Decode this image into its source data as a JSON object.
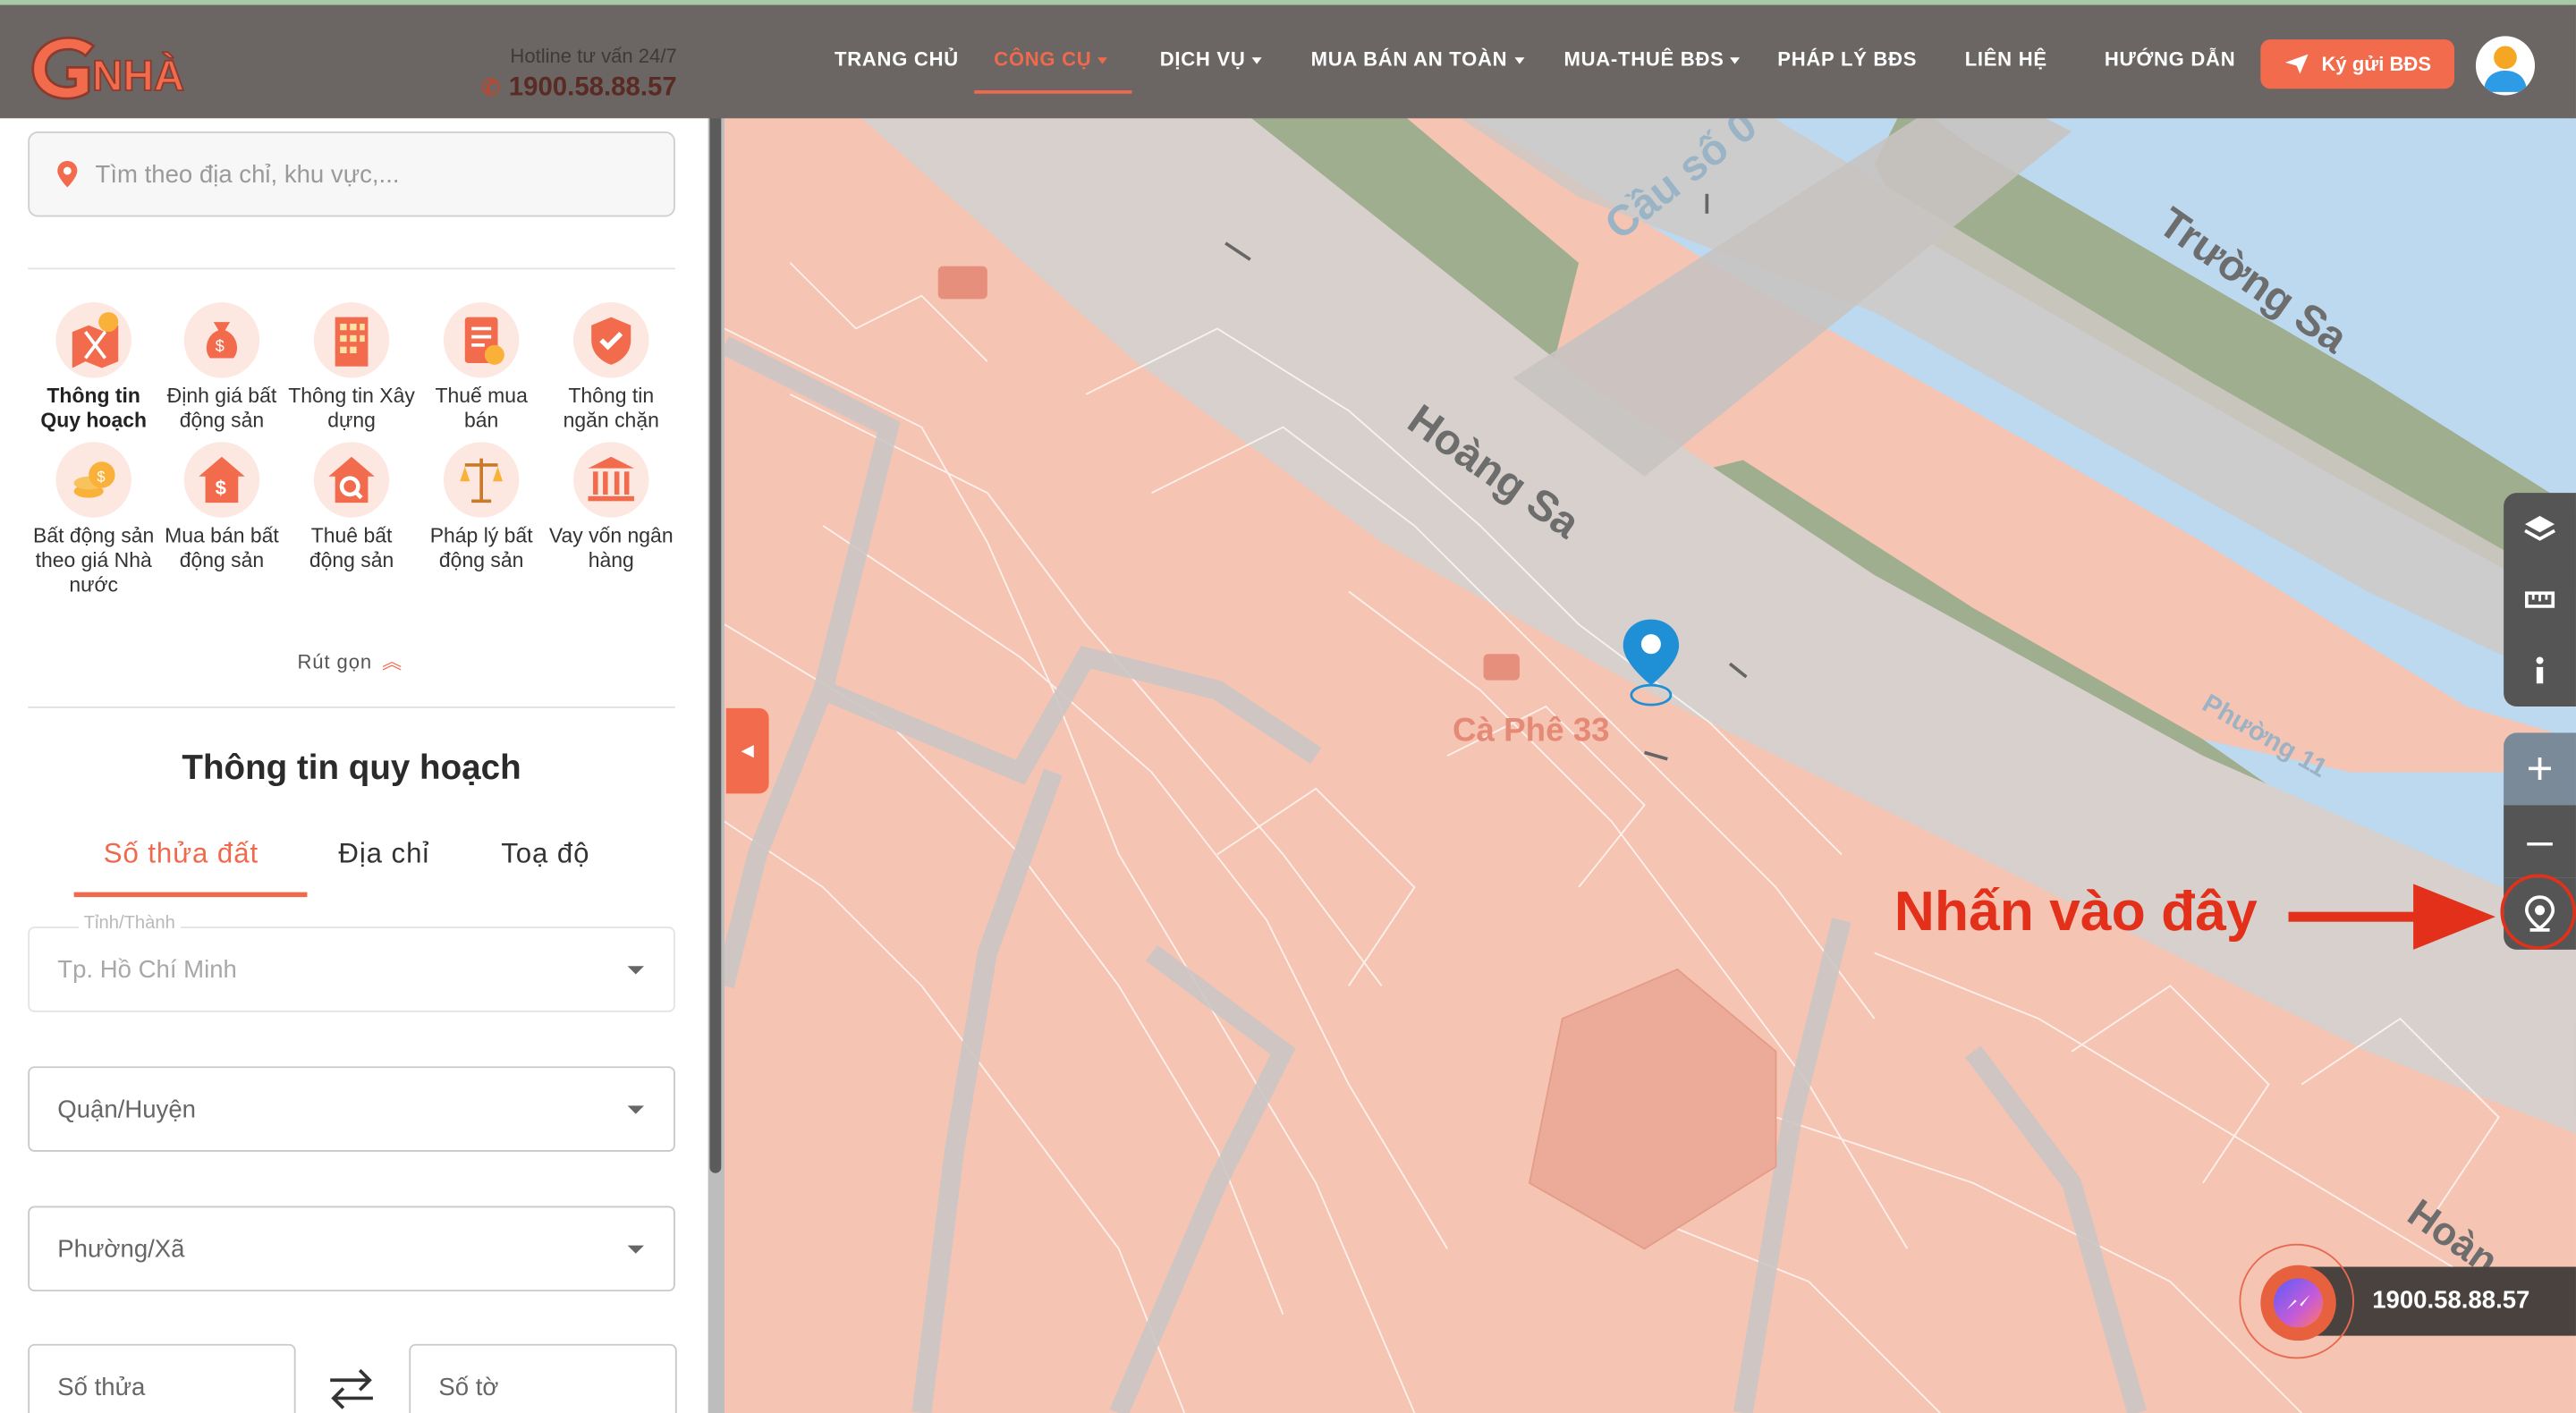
{
  "header": {
    "logo_text": "GNHÀ",
    "hotline_label": "Hotline tư vấn 24/7",
    "hotline_number": "1900.58.88.57",
    "nav": [
      {
        "label": "TRANG CHỦ",
        "has_dropdown": false,
        "active": false
      },
      {
        "label": "CÔNG CỤ",
        "has_dropdown": true,
        "active": true
      },
      {
        "label": "DỊCH VỤ",
        "has_dropdown": true,
        "active": false
      },
      {
        "label": "MUA BÁN AN TOÀN",
        "has_dropdown": true,
        "active": false
      },
      {
        "label": "MUA-THUÊ BĐS",
        "has_dropdown": true,
        "active": false
      },
      {
        "label": "PHÁP LÝ BĐS",
        "has_dropdown": false,
        "active": false
      },
      {
        "label": "LIÊN HỆ",
        "has_dropdown": false,
        "active": false
      },
      {
        "label": "HƯỚNG DẪN",
        "has_dropdown": false,
        "active": false
      }
    ],
    "deposit_label": "Ký gửi BĐS"
  },
  "sidebar": {
    "search_placeholder": "Tìm theo địa chỉ, khu vực,...",
    "tools": [
      {
        "label": "Thông tin Quy hoạch",
        "icon": "planning-map-icon"
      },
      {
        "label": "Định giá bất động sản",
        "icon": "money-bag-icon"
      },
      {
        "label": "Thông tin Xây dựng",
        "icon": "building-icon"
      },
      {
        "label": "Thuế mua bán",
        "icon": "tax-document-icon"
      },
      {
        "label": "Thông tin ngăn chặn",
        "icon": "shield-check-icon"
      },
      {
        "label": "Bất động sản theo giá Nhà nước",
        "icon": "coins-icon"
      },
      {
        "label": "Mua bán bất động sản",
        "icon": "house-dollar-icon"
      },
      {
        "label": "Thuê bất động sản",
        "icon": "house-search-icon"
      },
      {
        "label": "Pháp lý bất động sản",
        "icon": "scales-icon"
      },
      {
        "label": "Vay vốn ngân hàng",
        "icon": "bank-icon"
      }
    ],
    "collapse_label": "Rút gọn",
    "section_title": "Thông tin quy hoạch",
    "tabs": [
      "Số thửa đất",
      "Địa chỉ",
      "Toạ độ"
    ],
    "province_label": "Tỉnh/Thành",
    "province_value": "Tp. Hồ Chí Minh",
    "district_placeholder": "Quận/Huyện",
    "ward_placeholder": "Phường/Xã",
    "parcel_placeholder": "Số thửa",
    "sheet_placeholder": "Số tờ"
  },
  "map": {
    "labels": [
      "Cầu số 0",
      "Trường Sa",
      "Hoàng Sa",
      "Phường 11",
      "Cà Phê 33",
      "Hoàn"
    ],
    "annotation": "Nhấn vào đây",
    "hotline_pill": "1900.58.88.57"
  },
  "colors": {
    "accent": "#ef6a4d",
    "header_bg": "#6b6564",
    "annotation_red": "#e3301a",
    "map_land": "#f6c4b3",
    "map_water": "#bcd9ef",
    "map_road": "#d8d0cc",
    "map_green": "#9fae8e"
  }
}
